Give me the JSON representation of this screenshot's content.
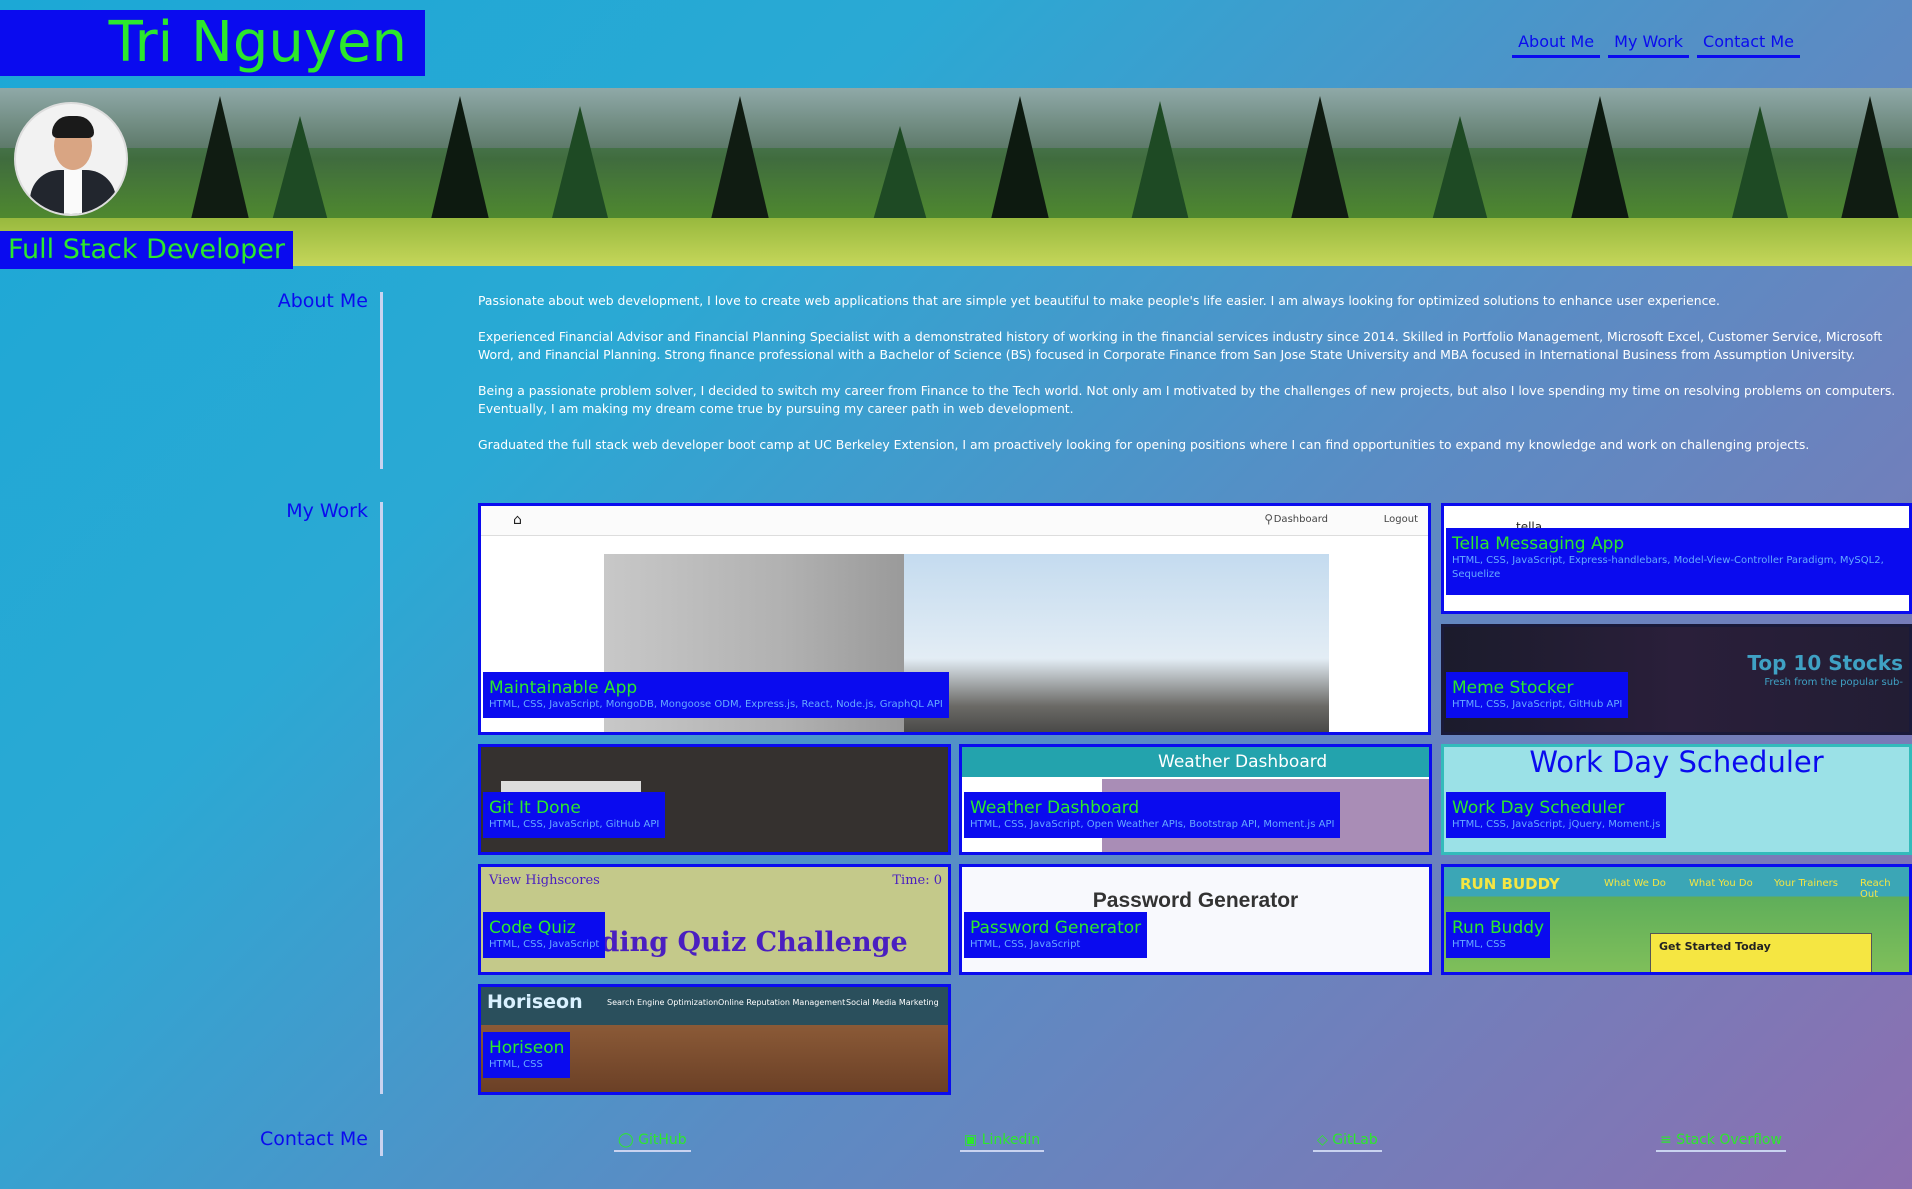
{
  "header": {
    "name": "Tri Nguyen",
    "nav": [
      "About Me",
      "My Work",
      "Contact Me"
    ]
  },
  "hero": {
    "tagline": "Full Stack Developer"
  },
  "about": {
    "label": "About Me",
    "paragraphs": [
      "Passionate about web development, I love to create web applications that are simple yet beautiful to make people's life easier. I am always looking for optimized solutions to enhance user experience.",
      "Experienced Financial Advisor and Financial Planning Specialist with a demonstrated history of working in the financial services industry since 2014. Skilled in Portfolio Management, Microsoft Excel, Customer Service, Microsoft Word, and Financial Planning. Strong finance professional with a Bachelor of Science (BS) focused in Corporate Finance from San Jose State University and MBA focused in International Business from Assumption University.",
      "Being a passionate problem solver, I decided to switch my career from Finance to the Tech world. Not only am I motivated by the challenges of new projects, but also I love spending my time on resolving problems on computers. Eventually, I am making my dream come true by pursuing my career path in web development.",
      "Graduated the full stack web developer boot camp at UC Berkeley Extension, I am proactively looking for opening positions where I can find opportunities to expand my knowledge and work on challenging projects."
    ]
  },
  "work": {
    "label": "My Work",
    "projects": [
      {
        "title": "Maintainable App",
        "tech": "HTML, CSS, JavaScript, MongoDB, Mongoose ODM, Express.js, React, Node.js, GraphQL API",
        "nav_dashboard": "Dashboard",
        "nav_logout": "Logout"
      },
      {
        "title": "Tella Messaging App",
        "tech": "HTML, CSS, JavaScript, Express-handlebars, Model-View-Controller Paradigm, MySQL2, Sequelize",
        "brand": "tella"
      },
      {
        "title": "Meme Stocker",
        "tech": "HTML, CSS, JavaScript, GitHub API",
        "headline": "Top 10 Stocks",
        "sub": "Fresh from the popular sub-"
      },
      {
        "title": "Git It Done",
        "tech": "HTML, CSS, JavaScript, GitHub API"
      },
      {
        "title": "Weather Dashboard",
        "tech": "HTML, CSS, JavaScript, Open Weather APIs, Bootstrap API, Moment.js API",
        "banner": "Weather Dashboard"
      },
      {
        "title": "Work Day Scheduler",
        "tech": "HTML, CSS, JavaScript, jQuery, Moment.js",
        "banner": "Work Day Scheduler"
      },
      {
        "title": "Code Quiz",
        "tech": "HTML, CSS, JavaScript",
        "view": "View Highscores",
        "time": "Time: 0",
        "heading": "Coding Quiz Challenge"
      },
      {
        "title": "Password Generator",
        "tech": "HTML, CSS, JavaScript",
        "heading": "Password Generator"
      },
      {
        "title": "Run Buddy",
        "tech": "HTML, CSS",
        "brand": "RUN BUDDY",
        "menu": [
          "What We Do",
          "What You Do",
          "Your Trainers",
          "Reach Out"
        ],
        "cta": "Get Started Today"
      },
      {
        "title": "Horiseon",
        "tech": "HTML, CSS",
        "brand": "Horiseon",
        "menu": [
          "Search Engine Optimization",
          "Online Reputation Management",
          "Social Media Marketing"
        ]
      }
    ]
  },
  "contact": {
    "label": "Contact Me",
    "links": [
      "GitHub",
      "Linkedin",
      "GitLab",
      "Stack Overflow"
    ]
  },
  "colors": {
    "accent": "#0a0bef",
    "green": "#2ce82c"
  }
}
